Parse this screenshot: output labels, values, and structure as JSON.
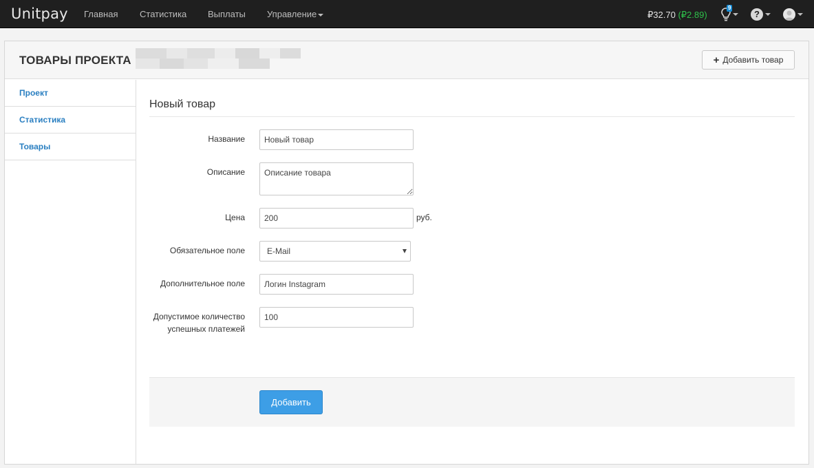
{
  "navbar": {
    "brand": "Unitpay",
    "items": [
      {
        "label": "Главная"
      },
      {
        "label": "Статистика"
      },
      {
        "label": "Выплаты"
      },
      {
        "label": "Управление"
      }
    ],
    "balance": "₽32.70",
    "balance_delta": "(₽2.89)",
    "notification_count": "9",
    "icons": [
      "lightbulb-icon",
      "help-icon",
      "user-avatar-icon"
    ]
  },
  "page": {
    "title": "ТОВАРЫ ПРОЕКТА",
    "add_button_label": "Добавить товар"
  },
  "sidebar": {
    "items": [
      {
        "label": "Проект"
      },
      {
        "label": "Статистика"
      },
      {
        "label": "Товары"
      }
    ]
  },
  "form": {
    "title": "Новый товар",
    "fields": {
      "name": {
        "label": "Название",
        "value": "Новый товар"
      },
      "description": {
        "label": "Описание",
        "value": "Описание товара"
      },
      "price": {
        "label": "Цена",
        "value": "200",
        "unit": "руб."
      },
      "required_field": {
        "label": "Обязательное поле",
        "value": "E-Mail"
      },
      "extra_field": {
        "label": "Дополнительное поле",
        "value": "Логин Instagram"
      },
      "max_payments": {
        "label": "Допустимое количество успешных платежей",
        "value": "100"
      }
    },
    "submit_label": "Добавить"
  },
  "colors": {
    "navbar_bg": "#1f1f1f",
    "link_blue": "#2a7fc1",
    "primary_button": "#3d9ee6",
    "positive_green": "#2ec04a"
  }
}
